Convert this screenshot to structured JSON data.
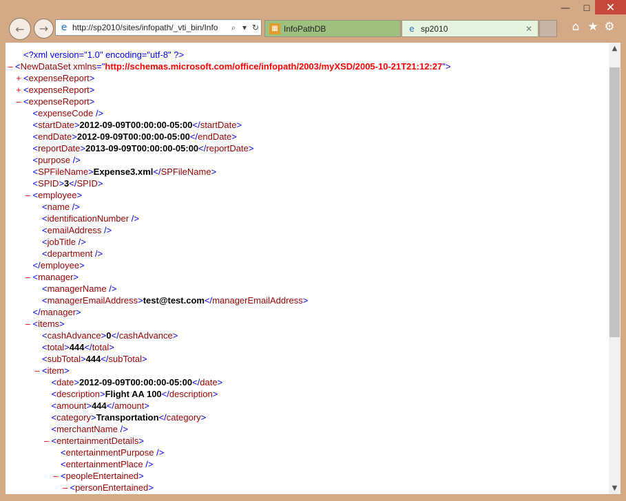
{
  "window": {
    "minimize_glyph": "—",
    "maximize_glyph": "☐",
    "close_glyph": "✕"
  },
  "nav": {
    "back_glyph": "←",
    "forward_glyph": "→"
  },
  "address_bar": {
    "url": "http://sp2010/sites/infopath/_vti_bin/Info",
    "icon": "ie-logo-icon",
    "search_glyph": "⌕",
    "dropdown_glyph": "▾",
    "refresh_glyph": "↻"
  },
  "tabs": [
    {
      "label": "InfoPathDB",
      "icon": "infopath-db-icon",
      "active": false
    },
    {
      "label": "sp2010",
      "icon": "ie-logo-icon",
      "active": true,
      "close_glyph": "✕"
    }
  ],
  "toolbar": {
    "home_glyph": "⌂",
    "favorites_glyph": "★",
    "settings_glyph": "⚙"
  },
  "scrollbar": {
    "up_glyph": "▲",
    "down_glyph": "▼",
    "thumb_start": 0.03,
    "thumb_end": 0.66
  },
  "xml": {
    "declaration": "<?xml version=\"1.0\" encoding=\"utf-8\" ?>",
    "root_tag": "NewDataSet",
    "root_attr_name": "xmlns",
    "root_attr_value": "http://schemas.microsoft.com/office/infopath/2003/myXSD/2005-10-21T21:12:27",
    "lines": [
      {
        "depth": 0,
        "toggle": "+",
        "kind": "open",
        "tag": "expenseReport"
      },
      {
        "depth": 0,
        "toggle": "+",
        "kind": "open",
        "tag": "expenseReport"
      },
      {
        "depth": 0,
        "toggle": "–",
        "kind": "open",
        "tag": "expenseReport"
      },
      {
        "depth": 1,
        "toggle": "",
        "kind": "empty",
        "tag": "expenseCode"
      },
      {
        "depth": 1,
        "toggle": "",
        "kind": "value",
        "tag": "startDate",
        "value": "2012-09-09T00:00:00-05:00"
      },
      {
        "depth": 1,
        "toggle": "",
        "kind": "value",
        "tag": "endDate",
        "value": "2012-09-09T00:00:00-05:00"
      },
      {
        "depth": 1,
        "toggle": "",
        "kind": "value",
        "tag": "reportDate",
        "value": "2013-09-09T00:00:00-05:00"
      },
      {
        "depth": 1,
        "toggle": "",
        "kind": "empty",
        "tag": "purpose"
      },
      {
        "depth": 1,
        "toggle": "",
        "kind": "value",
        "tag": "SPFileName",
        "value": "Expense3.xml"
      },
      {
        "depth": 1,
        "toggle": "",
        "kind": "value",
        "tag": "SPID",
        "value": "3"
      },
      {
        "depth": 1,
        "toggle": "–",
        "kind": "open",
        "tag": "employee"
      },
      {
        "depth": 2,
        "toggle": "",
        "kind": "empty",
        "tag": "name"
      },
      {
        "depth": 2,
        "toggle": "",
        "kind": "empty",
        "tag": "identificationNumber"
      },
      {
        "depth": 2,
        "toggle": "",
        "kind": "empty",
        "tag": "emailAddress"
      },
      {
        "depth": 2,
        "toggle": "",
        "kind": "empty",
        "tag": "jobTitle"
      },
      {
        "depth": 2,
        "toggle": "",
        "kind": "empty",
        "tag": "department"
      },
      {
        "depth": 1,
        "toggle": "",
        "kind": "close",
        "tag": "employee"
      },
      {
        "depth": 1,
        "toggle": "–",
        "kind": "open",
        "tag": "manager"
      },
      {
        "depth": 2,
        "toggle": "",
        "kind": "empty",
        "tag": "managerName"
      },
      {
        "depth": 2,
        "toggle": "",
        "kind": "value",
        "tag": "managerEmailAddress",
        "value": "test@test.com"
      },
      {
        "depth": 1,
        "toggle": "",
        "kind": "close",
        "tag": "manager"
      },
      {
        "depth": 1,
        "toggle": "–",
        "kind": "open",
        "tag": "items"
      },
      {
        "depth": 2,
        "toggle": "",
        "kind": "value",
        "tag": "cashAdvance",
        "value": "0"
      },
      {
        "depth": 2,
        "toggle": "",
        "kind": "value",
        "tag": "total",
        "value": "444"
      },
      {
        "depth": 2,
        "toggle": "",
        "kind": "value",
        "tag": "subTotal",
        "value": "444"
      },
      {
        "depth": 2,
        "toggle": "–",
        "kind": "open",
        "tag": "item"
      },
      {
        "depth": 3,
        "toggle": "",
        "kind": "value",
        "tag": "date",
        "value": "2012-09-09T00:00:00-05:00"
      },
      {
        "depth": 3,
        "toggle": "",
        "kind": "value",
        "tag": "description",
        "value": "Flight AA 100"
      },
      {
        "depth": 3,
        "toggle": "",
        "kind": "value",
        "tag": "amount",
        "value": "444"
      },
      {
        "depth": 3,
        "toggle": "",
        "kind": "value",
        "tag": "category",
        "value": "Transportation"
      },
      {
        "depth": 3,
        "toggle": "",
        "kind": "empty",
        "tag": "merchantName"
      },
      {
        "depth": 3,
        "toggle": "–",
        "kind": "open",
        "tag": "entertainmentDetails"
      },
      {
        "depth": 4,
        "toggle": "",
        "kind": "empty",
        "tag": "entertainmentPurpose"
      },
      {
        "depth": 4,
        "toggle": "",
        "kind": "empty",
        "tag": "entertainmentPlace"
      },
      {
        "depth": 4,
        "toggle": "–",
        "kind": "open",
        "tag": "peopleEntertained"
      },
      {
        "depth": 5,
        "toggle": "–",
        "kind": "open",
        "tag": "personEntertained"
      }
    ]
  }
}
